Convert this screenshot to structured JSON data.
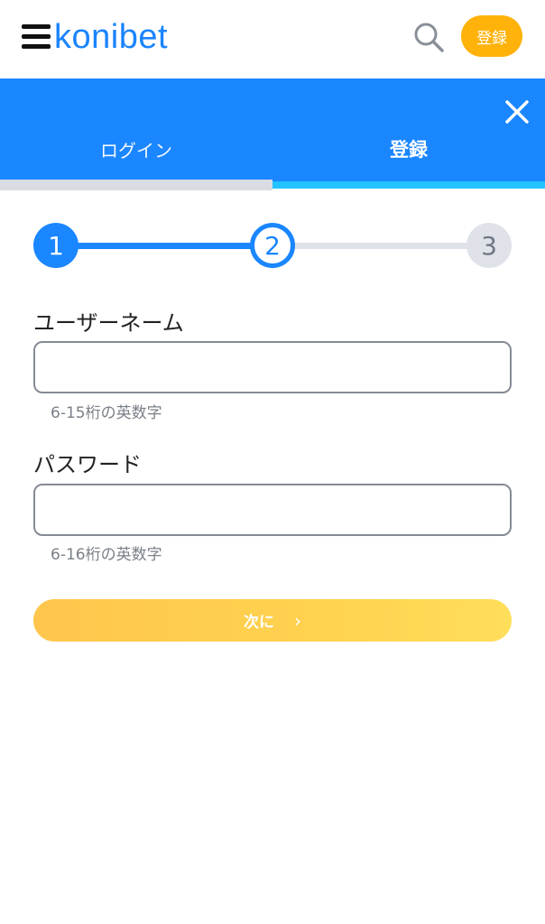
{
  "header": {
    "logo_text": "konibet",
    "register_label": "登録",
    "icons": {
      "menu": "hamburger-menu-icon",
      "search": "search-icon"
    }
  },
  "tabs": {
    "login_label": "ログイン",
    "register_label": "登録",
    "active": "register",
    "close_icon": "close-icon"
  },
  "stepper": {
    "steps": [
      "1",
      "2",
      "3"
    ],
    "current_step": 2
  },
  "form": {
    "username": {
      "label": "ユーザーネーム",
      "value": "",
      "placeholder": "",
      "hint": "6-15桁の英数字"
    },
    "password": {
      "label": "パスワード",
      "value": "",
      "placeholder": "",
      "hint": "6-16桁の英数字"
    },
    "next_label": "次に"
  },
  "colors": {
    "brand_blue": "#1a86ff",
    "accent_cyan": "#22c3ff",
    "register_orange": "#ffb20a",
    "button_yellow": "#ffd24f"
  }
}
